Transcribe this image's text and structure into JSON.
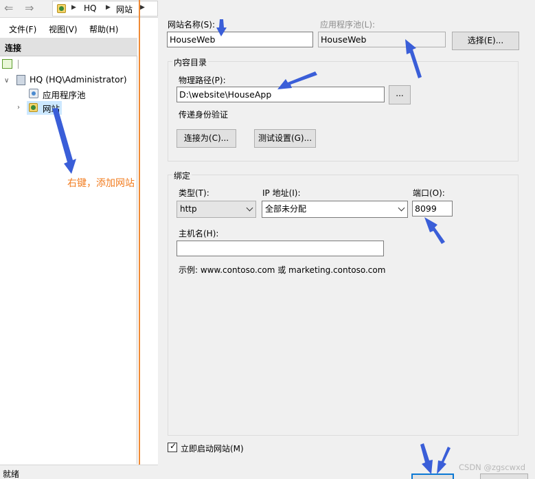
{
  "iis": {
    "breadcrumb": [
      "HQ",
      "网站"
    ],
    "menu": [
      "文件(F)",
      "视图(V)",
      "帮助(H)"
    ],
    "connections_title": "连接",
    "tree": {
      "server": "HQ (HQ\\Administrator)",
      "app_pools": "应用程序池",
      "sites": "网站"
    },
    "status": "就绪"
  },
  "annotation": "右键，添加网站",
  "dialog": {
    "site_name_label": "网站名称(S):",
    "site_name_value": "HouseWeb",
    "app_pool_label": "应用程序池(L):",
    "app_pool_value": "HouseWeb",
    "select_button": "选择(E)...",
    "content_dir_title": "内容目录",
    "physical_path_label": "物理路径(P):",
    "physical_path_value": "D:\\website\\HouseApp",
    "browse_button": "...",
    "passthrough_label": "传递身份验证",
    "connect_as_button": "连接为(C)...",
    "test_settings_button": "测试设置(G)...",
    "binding_title": "绑定",
    "type_label": "类型(T):",
    "type_value": "http",
    "ip_label": "IP 地址(I):",
    "ip_value": "全部未分配",
    "port_label": "端口(O):",
    "port_value": "8099",
    "hostname_label": "主机名(H):",
    "hostname_value": "",
    "example_text": "示例: www.contoso.com 或 marketing.contoso.com",
    "start_label": "立即启动网站(M)",
    "start_checked": true
  },
  "watermark": "CSDN @zgscwxd",
  "colors": {
    "arrow": "#3a5ed8",
    "annotation": "#f27c1f",
    "divider": "#ef8a35",
    "selection": "#cce8ff"
  }
}
